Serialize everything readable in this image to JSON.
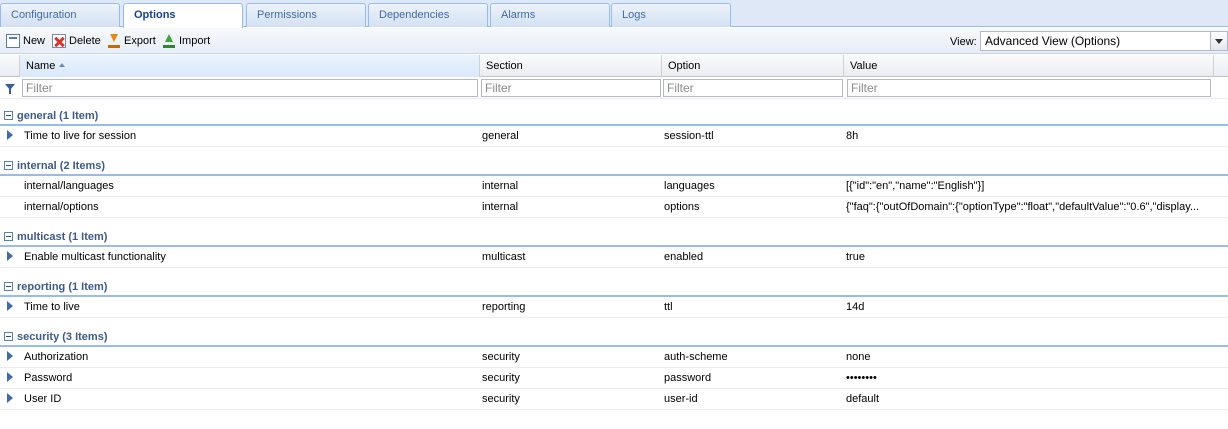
{
  "tabs": [
    {
      "label": "Configuration",
      "active": false
    },
    {
      "label": "Options",
      "active": true
    },
    {
      "label": "Permissions",
      "active": false
    },
    {
      "label": "Dependencies",
      "active": false
    },
    {
      "label": "Alarms",
      "active": false
    },
    {
      "label": "Logs",
      "active": false
    }
  ],
  "toolbar": {
    "new_label": "New",
    "delete_label": "Delete",
    "export_label": "Export",
    "import_label": "Import",
    "view_label": "View:",
    "view_value": "Advanced View (Options)"
  },
  "columns": {
    "name": "Name",
    "section": "Section",
    "option": "Option",
    "value": "Value"
  },
  "filter": {
    "placeholder": "Filter"
  },
  "groups": [
    {
      "title": "general (1 Item)",
      "rows": [
        {
          "name": "Time to live for session",
          "section": "general",
          "option": "session-ttl",
          "value": "8h",
          "expandable": true
        }
      ]
    },
    {
      "title": "internal (2 Items)",
      "rows": [
        {
          "name": "internal/languages",
          "section": "internal",
          "option": "languages",
          "value": "[{\"id\":\"en\",\"name\":\"English\"}]",
          "expandable": false
        },
        {
          "name": "internal/options",
          "section": "internal",
          "option": "options",
          "value": "{\"faq\":{\"outOfDomain\":{\"optionType\":\"float\",\"defaultValue\":\"0.6\",\"display...",
          "expandable": false
        }
      ]
    },
    {
      "title": "multicast (1 Item)",
      "rows": [
        {
          "name": "Enable multicast functionality",
          "section": "multicast",
          "option": "enabled",
          "value": "true",
          "expandable": true
        }
      ]
    },
    {
      "title": "reporting (1 Item)",
      "rows": [
        {
          "name": "Time to live",
          "section": "reporting",
          "option": "ttl",
          "value": "14d",
          "expandable": true
        }
      ]
    },
    {
      "title": "security (3 Items)",
      "rows": [
        {
          "name": "Authorization",
          "section": "security",
          "option": "auth-scheme",
          "value": "none",
          "expandable": true
        },
        {
          "name": "Password",
          "section": "security",
          "option": "password",
          "value": "••••••••",
          "expandable": true
        },
        {
          "name": "User ID",
          "section": "security",
          "option": "user-id",
          "value": "default",
          "expandable": true
        }
      ]
    }
  ]
}
